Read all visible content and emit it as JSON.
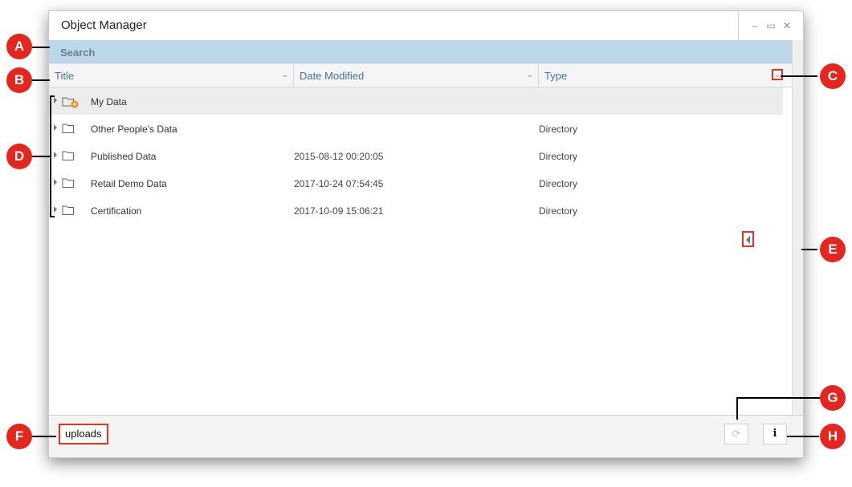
{
  "window": {
    "title": "Object Manager",
    "controls": {
      "minimize": "–",
      "maximize": "▭",
      "close": "✕"
    }
  },
  "search": {
    "label": "Search"
  },
  "columns": [
    {
      "label": "Title",
      "caret": "⌄"
    },
    {
      "label": "Date Modified",
      "caret": "⌄"
    },
    {
      "label": "Type",
      "caret": "⌄"
    }
  ],
  "rows": [
    {
      "name": "My Data",
      "date": "",
      "type": "",
      "icon": "folder-add-icon"
    },
    {
      "name": "Other People's Data",
      "date": "",
      "type": "Directory",
      "icon": "folder-icon"
    },
    {
      "name": "Published Data",
      "date": "2015-08-12 00:20:05",
      "type": "Directory",
      "icon": "folder-icon"
    },
    {
      "name": "Retail Demo Data",
      "date": "2017-10-24 07:54:45",
      "type": "Directory",
      "icon": "folder-icon"
    },
    {
      "name": "Certification",
      "date": "2017-10-09 15:06:21",
      "type": "Directory",
      "icon": "folder-icon"
    }
  ],
  "footer": {
    "path": "uploads",
    "refresh_icon": "⟳",
    "info_icon": "i"
  },
  "callouts": [
    "A",
    "B",
    "C",
    "D",
    "E",
    "F",
    "G",
    "H"
  ],
  "colors": {
    "search_bar": "#bcd6ea",
    "callout": "#e5261f",
    "highlight_box": "#e5351f",
    "folder_add_badge": "#f08a24"
  }
}
